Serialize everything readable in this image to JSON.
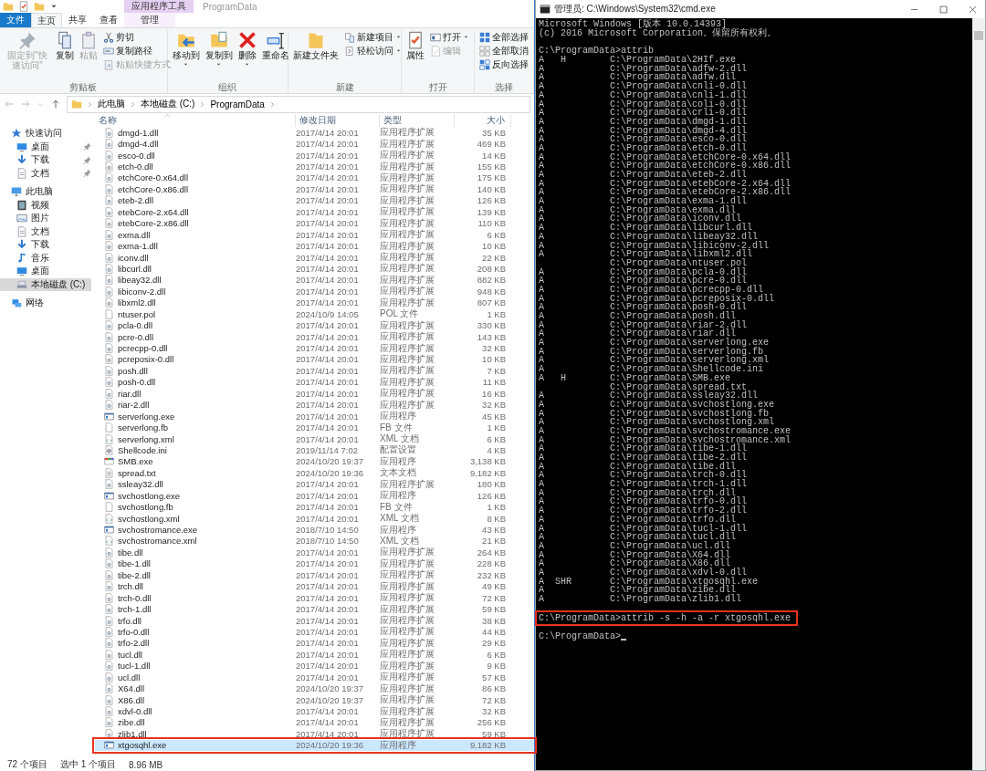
{
  "explorer": {
    "context_tab_group": "应用程序工具",
    "title": "ProgramData",
    "tabs": [
      {
        "label": "文件",
        "kind": "file",
        "selected": false
      },
      {
        "label": "主页",
        "kind": "tab",
        "selected": true
      },
      {
        "label": "共享",
        "kind": "tab",
        "selected": false
      },
      {
        "label": "查看",
        "kind": "tab",
        "selected": false
      },
      {
        "label": "管理",
        "kind": "context",
        "selected": false
      }
    ],
    "ribbon": [
      {
        "label": "剪贴板",
        "commands": [
          {
            "label": "固定到\"快速访问\"",
            "kind": "large",
            "disabled": true,
            "dropdown": false
          },
          {
            "label": "复制",
            "kind": "large",
            "disabled": false,
            "dropdown": false
          },
          {
            "label": "粘贴",
            "kind": "large",
            "disabled": true,
            "dropdown": false
          },
          {
            "label": "剪切",
            "kind": "small",
            "disabled": false,
            "dropdown": false
          },
          {
            "label": "复制路径",
            "kind": "small",
            "disabled": false,
            "dropdown": false
          },
          {
            "label": "粘贴快捷方式",
            "kind": "small",
            "disabled": true,
            "dropdown": false
          }
        ]
      },
      {
        "label": "组织",
        "commands": [
          {
            "label": "移动到",
            "kind": "large",
            "disabled": false,
            "dropdown": true
          },
          {
            "label": "复制到",
            "kind": "large",
            "disabled": false,
            "dropdown": true
          },
          {
            "label": "删除",
            "kind": "large",
            "disabled": false,
            "dropdown": true
          },
          {
            "label": "重命名",
            "kind": "large",
            "disabled": false,
            "dropdown": false
          }
        ]
      },
      {
        "label": "新建",
        "commands": [
          {
            "label": "新建文件夹",
            "kind": "large",
            "disabled": false,
            "dropdown": false
          },
          {
            "label": "新建项目",
            "kind": "small",
            "disabled": false,
            "dropdown": true
          },
          {
            "label": "轻松访问",
            "kind": "small",
            "disabled": false,
            "dropdown": true
          }
        ]
      },
      {
        "label": "打开",
        "commands": [
          {
            "label": "属性",
            "kind": "large",
            "disabled": false,
            "dropdown": false
          },
          {
            "label": "打开",
            "kind": "small",
            "disabled": false,
            "dropdown": true
          },
          {
            "label": "编辑",
            "kind": "small",
            "disabled": true,
            "dropdown": false
          }
        ]
      },
      {
        "label": "选择",
        "commands": [
          {
            "label": "全部选择",
            "kind": "small",
            "disabled": false,
            "dropdown": false
          },
          {
            "label": "全部取消",
            "kind": "small",
            "disabled": false,
            "dropdown": false
          },
          {
            "label": "反向选择",
            "kind": "small",
            "disabled": false,
            "dropdown": false
          }
        ]
      }
    ],
    "breadcrumb": [
      "此电脑",
      "本地磁盘 (C:)",
      "ProgramData"
    ],
    "sidebar": [
      {
        "label": "快速访问",
        "selected": false,
        "children": [
          {
            "label": "桌面",
            "pinned": true,
            "selected": false
          },
          {
            "label": "下载",
            "pinned": true,
            "selected": false
          },
          {
            "label": "文档",
            "pinned": true,
            "selected": false
          }
        ]
      },
      {
        "label": "此电脑",
        "selected": false,
        "children": [
          {
            "label": "视频",
            "pinned": false,
            "selected": false
          },
          {
            "label": "图片",
            "pinned": false,
            "selected": false
          },
          {
            "label": "文档",
            "pinned": false,
            "selected": false
          },
          {
            "label": "下载",
            "pinned": false,
            "selected": false
          },
          {
            "label": "音乐",
            "pinned": false,
            "selected": false
          },
          {
            "label": "桌面",
            "pinned": false,
            "selected": false
          },
          {
            "label": "本地磁盘 (C:)",
            "pinned": false,
            "selected": true
          }
        ]
      },
      {
        "label": "网络",
        "selected": false
      }
    ],
    "columns": [
      "名称",
      "修改日期",
      "类型",
      "大小"
    ],
    "rows": [
      {
        "name": "dmgd-1.dll",
        "date": "2017/4/14 20:01",
        "type": "应用程序扩展",
        "size": "35 KB",
        "kind": "dll",
        "selected": false,
        "highlighted": false
      },
      {
        "name": "dmgd-4.dll",
        "date": "2017/4/14 20:01",
        "type": "应用程序扩展",
        "size": "469 KB",
        "kind": "dll",
        "selected": false,
        "highlighted": false
      },
      {
        "name": "esco-0.dll",
        "date": "2017/4/14 20:01",
        "type": "应用程序扩展",
        "size": "14 KB",
        "kind": "dll",
        "selected": false,
        "highlighted": false
      },
      {
        "name": "etch-0.dll",
        "date": "2017/4/14 20:01",
        "type": "应用程序扩展",
        "size": "155 KB",
        "kind": "dll",
        "selected": false,
        "highlighted": false
      },
      {
        "name": "etchCore-0.x64.dll",
        "date": "2017/4/14 20:01",
        "type": "应用程序扩展",
        "size": "175 KB",
        "kind": "dll",
        "selected": false,
        "highlighted": false
      },
      {
        "name": "etchCore-0.x86.dll",
        "date": "2017/4/14 20:01",
        "type": "应用程序扩展",
        "size": "140 KB",
        "kind": "dll",
        "selected": false,
        "highlighted": false
      },
      {
        "name": "eteb-2.dll",
        "date": "2017/4/14 20:01",
        "type": "应用程序扩展",
        "size": "126 KB",
        "kind": "dll",
        "selected": false,
        "highlighted": false
      },
      {
        "name": "etebCore-2.x64.dll",
        "date": "2017/4/14 20:01",
        "type": "应用程序扩展",
        "size": "139 KB",
        "kind": "dll",
        "selected": false,
        "highlighted": false
      },
      {
        "name": "etebCore-2.x86.dll",
        "date": "2017/4/14 20:01",
        "type": "应用程序扩展",
        "size": "110 KB",
        "kind": "dll",
        "selected": false,
        "highlighted": false
      },
      {
        "name": "exma.dll",
        "date": "2017/4/14 20:01",
        "type": "应用程序扩展",
        "size": "6 KB",
        "kind": "dll",
        "selected": false,
        "highlighted": false
      },
      {
        "name": "exma-1.dll",
        "date": "2017/4/14 20:01",
        "type": "应用程序扩展",
        "size": "10 KB",
        "kind": "dll",
        "selected": false,
        "highlighted": false
      },
      {
        "name": "iconv.dll",
        "date": "2017/4/14 20:01",
        "type": "应用程序扩展",
        "size": "22 KB",
        "kind": "dll",
        "selected": false,
        "highlighted": false
      },
      {
        "name": "libcurl.dll",
        "date": "2017/4/14 20:01",
        "type": "应用程序扩展",
        "size": "208 KB",
        "kind": "dll",
        "selected": false,
        "highlighted": false
      },
      {
        "name": "libeay32.dll",
        "date": "2017/4/14 20:01",
        "type": "应用程序扩展",
        "size": "882 KB",
        "kind": "dll",
        "selected": false,
        "highlighted": false
      },
      {
        "name": "libiconv-2.dll",
        "date": "2017/4/14 20:01",
        "type": "应用程序扩展",
        "size": "948 KB",
        "kind": "dll",
        "selected": false,
        "highlighted": false
      },
      {
        "name": "libxml2.dll",
        "date": "2017/4/14 20:01",
        "type": "应用程序扩展",
        "size": "807 KB",
        "kind": "dll",
        "selected": false,
        "highlighted": false
      },
      {
        "name": "ntuser.pol",
        "date": "2024/10/9 14:05",
        "type": "POL 文件",
        "size": "1 KB",
        "kind": "blank",
        "selected": false,
        "highlighted": false
      },
      {
        "name": "pcla-0.dll",
        "date": "2017/4/14 20:01",
        "type": "应用程序扩展",
        "size": "330 KB",
        "kind": "dll",
        "selected": false,
        "highlighted": false
      },
      {
        "name": "pcre-0.dll",
        "date": "2017/4/14 20:01",
        "type": "应用程序扩展",
        "size": "143 KB",
        "kind": "dll",
        "selected": false,
        "highlighted": false
      },
      {
        "name": "pcrecpp-0.dll",
        "date": "2017/4/14 20:01",
        "type": "应用程序扩展",
        "size": "32 KB",
        "kind": "dll",
        "selected": false,
        "highlighted": false
      },
      {
        "name": "pcreposix-0.dll",
        "date": "2017/4/14 20:01",
        "type": "应用程序扩展",
        "size": "10 KB",
        "kind": "dll",
        "selected": false,
        "highlighted": false
      },
      {
        "name": "posh.dll",
        "date": "2017/4/14 20:01",
        "type": "应用程序扩展",
        "size": "7 KB",
        "kind": "dll",
        "selected": false,
        "highlighted": false
      },
      {
        "name": "posh-0.dll",
        "date": "2017/4/14 20:01",
        "type": "应用程序扩展",
        "size": "11 KB",
        "kind": "dll",
        "selected": false,
        "highlighted": false
      },
      {
        "name": "riar.dll",
        "date": "2017/4/14 20:01",
        "type": "应用程序扩展",
        "size": "16 KB",
        "kind": "dll",
        "selected": false,
        "highlighted": false
      },
      {
        "name": "riar-2.dll",
        "date": "2017/4/14 20:01",
        "type": "应用程序扩展",
        "size": "32 KB",
        "kind": "dll",
        "selected": false,
        "highlighted": false
      },
      {
        "name": "serverlong.exe",
        "date": "2017/4/14 20:01",
        "type": "应用程序",
        "size": "45 KB",
        "kind": "exe",
        "selected": false,
        "highlighted": false
      },
      {
        "name": "serverlong.fb",
        "date": "2017/4/14 20:01",
        "type": "FB 文件",
        "size": "1 KB",
        "kind": "blank",
        "selected": false,
        "highlighted": false
      },
      {
        "name": "serverlong.xml",
        "date": "2017/4/14 20:01",
        "type": "XML 文档",
        "size": "6 KB",
        "kind": "xml",
        "selected": false,
        "highlighted": false
      },
      {
        "name": "Shellcode.ini",
        "date": "2019/11/14 7:02",
        "type": "配置设置",
        "size": "4 KB",
        "kind": "ini",
        "selected": false,
        "highlighted": false
      },
      {
        "name": "SMB.exe",
        "date": "2024/10/20 19:37",
        "type": "应用程序",
        "size": "3,138 KB",
        "kind": "app",
        "selected": false,
        "highlighted": false
      },
      {
        "name": "spread.txt",
        "date": "2024/10/20 19:36",
        "type": "文本文档",
        "size": "9,182 KB",
        "kind": "txt",
        "selected": false,
        "highlighted": false
      },
      {
        "name": "ssleay32.dll",
        "date": "2017/4/14 20:01",
        "type": "应用程序扩展",
        "size": "180 KB",
        "kind": "dll",
        "selected": false,
        "highlighted": false
      },
      {
        "name": "svchostlong.exe",
        "date": "2017/4/14 20:01",
        "type": "应用程序",
        "size": "126 KB",
        "kind": "exe",
        "selected": false,
        "highlighted": false
      },
      {
        "name": "svchostlong.fb",
        "date": "2017/4/14 20:01",
        "type": "FB 文件",
        "size": "1 KB",
        "kind": "blank",
        "selected": false,
        "highlighted": false
      },
      {
        "name": "svchostlong.xml",
        "date": "2017/4/14 20:01",
        "type": "XML 文档",
        "size": "8 KB",
        "kind": "xml",
        "selected": false,
        "highlighted": false
      },
      {
        "name": "svchostromance.exe",
        "date": "2018/7/10 14:50",
        "type": "应用程序",
        "size": "43 KB",
        "kind": "exe",
        "selected": false,
        "highlighted": false
      },
      {
        "name": "svchostromance.xml",
        "date": "2018/7/10 14:50",
        "type": "XML 文档",
        "size": "21 KB",
        "kind": "xml",
        "selected": false,
        "highlighted": false
      },
      {
        "name": "tibe.dll",
        "date": "2017/4/14 20:01",
        "type": "应用程序扩展",
        "size": "264 KB",
        "kind": "dll",
        "selected": false,
        "highlighted": false
      },
      {
        "name": "tibe-1.dll",
        "date": "2017/4/14 20:01",
        "type": "应用程序扩展",
        "size": "228 KB",
        "kind": "dll",
        "selected": false,
        "highlighted": false
      },
      {
        "name": "tibe-2.dll",
        "date": "2017/4/14 20:01",
        "type": "应用程序扩展",
        "size": "232 KB",
        "kind": "dll",
        "selected": false,
        "highlighted": false
      },
      {
        "name": "trch.dll",
        "date": "2017/4/14 20:01",
        "type": "应用程序扩展",
        "size": "49 KB",
        "kind": "dll",
        "selected": false,
        "highlighted": false
      },
      {
        "name": "trch-0.dll",
        "date": "2017/4/14 20:01",
        "type": "应用程序扩展",
        "size": "72 KB",
        "kind": "dll",
        "selected": false,
        "highlighted": false
      },
      {
        "name": "trch-1.dll",
        "date": "2017/4/14 20:01",
        "type": "应用程序扩展",
        "size": "59 KB",
        "kind": "dll",
        "selected": false,
        "highlighted": false
      },
      {
        "name": "trfo.dll",
        "date": "2017/4/14 20:01",
        "type": "应用程序扩展",
        "size": "38 KB",
        "kind": "dll",
        "selected": false,
        "highlighted": false
      },
      {
        "name": "trfo-0.dll",
        "date": "2017/4/14 20:01",
        "type": "应用程序扩展",
        "size": "44 KB",
        "kind": "dll",
        "selected": false,
        "highlighted": false
      },
      {
        "name": "trfo-2.dll",
        "date": "2017/4/14 20:01",
        "type": "应用程序扩展",
        "size": "29 KB",
        "kind": "dll",
        "selected": false,
        "highlighted": false
      },
      {
        "name": "tucl.dll",
        "date": "2017/4/14 20:01",
        "type": "应用程序扩展",
        "size": "6 KB",
        "kind": "dll",
        "selected": false,
        "highlighted": false
      },
      {
        "name": "tucl-1.dll",
        "date": "2017/4/14 20:01",
        "type": "应用程序扩展",
        "size": "9 KB",
        "kind": "dll",
        "selected": false,
        "highlighted": false
      },
      {
        "name": "ucl.dll",
        "date": "2017/4/14 20:01",
        "type": "应用程序扩展",
        "size": "57 KB",
        "kind": "dll",
        "selected": false,
        "highlighted": false
      },
      {
        "name": "X64.dll",
        "date": "2024/10/20 19:37",
        "type": "应用程序扩展",
        "size": "86 KB",
        "kind": "dll",
        "selected": false,
        "highlighted": false
      },
      {
        "name": "X86.dll",
        "date": "2024/10/20 19:37",
        "type": "应用程序扩展",
        "size": "72 KB",
        "kind": "dll",
        "selected": false,
        "highlighted": false
      },
      {
        "name": "xdvl-0.dll",
        "date": "2017/4/14 20:01",
        "type": "应用程序扩展",
        "size": "32 KB",
        "kind": "dll",
        "selected": false,
        "highlighted": false
      },
      {
        "name": "zibe.dll",
        "date": "2017/4/14 20:01",
        "type": "应用程序扩展",
        "size": "256 KB",
        "kind": "dll",
        "selected": false,
        "highlighted": false
      },
      {
        "name": "zlib1.dll",
        "date": "2017/4/14 20:01",
        "type": "应用程序扩展",
        "size": "59 KB",
        "kind": "dll",
        "selected": false,
        "highlighted": false
      },
      {
        "name": "xtgosqhl.exe",
        "date": "2024/10/20 19:36",
        "type": "应用程序",
        "size": "9,182 KB",
        "kind": "exe",
        "selected": true,
        "highlighted": true
      }
    ],
    "status_bar": [
      "72 个项目",
      "选中 1 个项目",
      "8.96 MB"
    ]
  },
  "console": {
    "title": "管理员: C:\\Windows\\System32\\cmd.exe",
    "blocks": [
      {
        "highlighted": false,
        "cursor": false,
        "lines": [
          "Microsoft Windows [版本 10.0.14393]",
          "(c) 2016 Microsoft Corporation。保留所有权利。"
        ]
      },
      {
        "highlighted": false,
        "cursor": false,
        "lines": [
          "C:\\ProgramData>attrib",
          "A   H        C:\\ProgramData\\2HIf.exe",
          "A            C:\\ProgramData\\adfw-2.dll",
          "A            C:\\ProgramData\\adfw.dll",
          "A            C:\\ProgramData\\cnli-0.dll",
          "A            C:\\ProgramData\\cnli-1.dll",
          "A            C:\\ProgramData\\coli-0.dll",
          "A            C:\\ProgramData\\crli-0.dll",
          "A            C:\\ProgramData\\dmgd-1.dll",
          "A            C:\\ProgramData\\dmgd-4.dll",
          "A            C:\\ProgramData\\esco-0.dll",
          "A            C:\\ProgramData\\etch-0.dll",
          "A            C:\\ProgramData\\etchCore-0.x64.dll",
          "A            C:\\ProgramData\\etchCore-0.x86.dll",
          "A            C:\\ProgramData\\eteb-2.dll",
          "A            C:\\ProgramData\\etebCore-2.x64.dll",
          "A            C:\\ProgramData\\etebCore-2.x86.dll",
          "A            C:\\ProgramData\\exma-1.dll",
          "A            C:\\ProgramData\\exma.dll",
          "A            C:\\ProgramData\\iconv.dll",
          "A            C:\\ProgramData\\libcurl.dll",
          "A            C:\\ProgramData\\libeay32.dll",
          "A            C:\\ProgramData\\libiconv-2.dll",
          "A            C:\\ProgramData\\libxml2.dll",
          "             C:\\ProgramData\\ntuser.pol",
          "A            C:\\ProgramData\\pcla-0.dll",
          "A            C:\\ProgramData\\pcre-0.dll",
          "A            C:\\ProgramData\\pcrecpp-0.dll",
          "A            C:\\ProgramData\\pcreposix-0.dll",
          "A            C:\\ProgramData\\posh-0.dll",
          "A            C:\\ProgramData\\posh.dll",
          "A            C:\\ProgramData\\riar-2.dll",
          "A            C:\\ProgramData\\riar.dll",
          "A            C:\\ProgramData\\serverlong.exe",
          "A            C:\\ProgramData\\serverlong.fb",
          "A            C:\\ProgramData\\serverlong.xml",
          "A            C:\\ProgramData\\Shellcode.ini",
          "A   H        C:\\ProgramData\\SMB.exe",
          "             C:\\ProgramData\\spread.txt",
          "A            C:\\ProgramData\\ssleay32.dll",
          "A            C:\\ProgramData\\svchostlong.exe",
          "A            C:\\ProgramData\\svchostlong.fb",
          "A            C:\\ProgramData\\svchostlong.xml",
          "A            C:\\ProgramData\\svchostromance.exe",
          "A            C:\\ProgramData\\svchostromance.xml",
          "A            C:\\ProgramData\\tibe-1.dll",
          "A            C:\\ProgramData\\tibe-2.dll",
          "A            C:\\ProgramData\\tibe.dll",
          "A            C:\\ProgramData\\trch-0.dll",
          "A            C:\\ProgramData\\trch-1.dll",
          "A            C:\\ProgramData\\trch.dll",
          "A            C:\\ProgramData\\trfo-0.dll",
          "A            C:\\ProgramData\\trfo-2.dll",
          "A            C:\\ProgramData\\trfo.dll",
          "A            C:\\ProgramData\\tucl-1.dll",
          "A            C:\\ProgramData\\tucl.dll",
          "A            C:\\ProgramData\\ucl.dll",
          "A            C:\\ProgramData\\X64.dll",
          "A            C:\\ProgramData\\X86.dll",
          "A            C:\\ProgramData\\xdvl-0.dll",
          "A  SHR       C:\\ProgramData\\xtgosqhl.exe",
          "A            C:\\ProgramData\\zibe.dll",
          "A            C:\\ProgramData\\zlib1.dll"
        ]
      },
      {
        "highlighted": true,
        "cursor": false,
        "lines": [
          "C:\\ProgramData>attrib -s -h -a -r xtgosqhl.exe"
        ]
      },
      {
        "highlighted": false,
        "cursor": true,
        "lines": [
          "C:\\ProgramData>"
        ]
      }
    ]
  }
}
